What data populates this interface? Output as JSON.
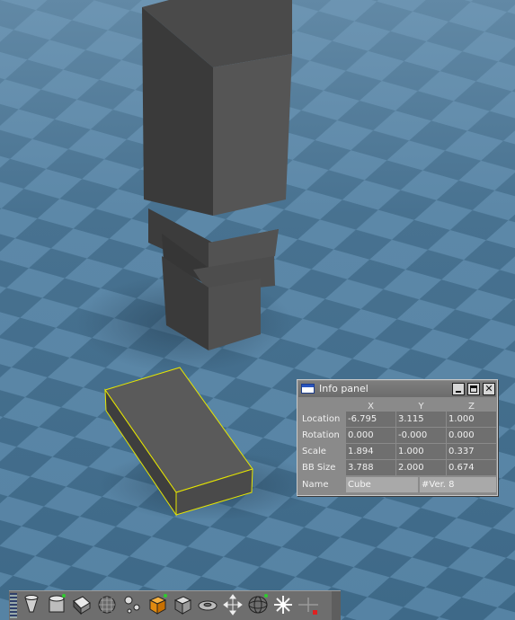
{
  "info_panel": {
    "title": "Info panel",
    "columns": [
      "X",
      "Y",
      "Z"
    ],
    "rows": [
      {
        "label": "Location",
        "x": "-6.795",
        "y": "3.115",
        "z": "1.000"
      },
      {
        "label": "Rotation",
        "x": "0.000",
        "y": "-0.000",
        "z": "0.000"
      },
      {
        "label": "Scale",
        "x": "1.894",
        "y": "1.000",
        "z": "0.337"
      },
      {
        "label": "BB Size",
        "x": "3.788",
        "y": "2.000",
        "z": "0.674"
      }
    ],
    "name_label": "Name",
    "name_value": "Cube",
    "vertex_info": "#Ver. 8"
  },
  "toolbar": {
    "tools": [
      "cone-icon",
      "cylinder-icon",
      "box-icon",
      "grid-sphere-icon",
      "point-lights-icon",
      "cube-icon",
      "box-icon",
      "torus-icon",
      "move-icon",
      "rotate-icon",
      "sun-icon",
      "plane-icon"
    ]
  },
  "colors": {
    "floor_light": "#5a83a3",
    "floor_dark": "#3f6886",
    "selection": "#e6e600",
    "panel_bg": "#8a8a8a"
  }
}
